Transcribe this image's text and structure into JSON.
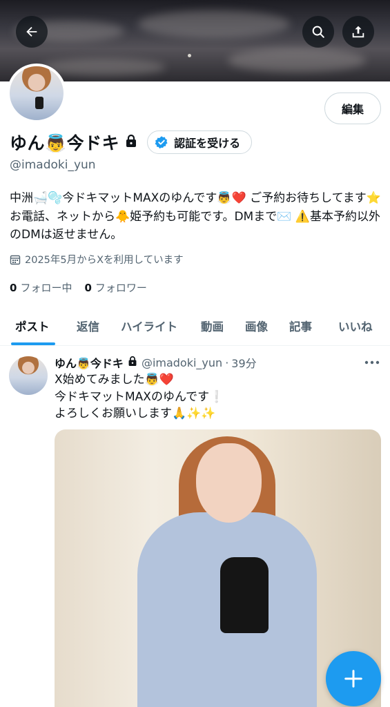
{
  "profile": {
    "name": "ゆん👼今ドキ",
    "handle": "@imadoki_yun",
    "edit_label": "編集",
    "verify_label": "認証を受ける",
    "bio": "中洲🛁🫧今ドキマットMAXのゆんです👼❤️ ご予約お待ちしてます⭐お電話、ネットから🐥姫予約も可能です。DMまで✉️ ⚠️基本予約以外のDMは返せません。",
    "joined": "2025年5月からXを利用しています",
    "following_count": "0",
    "following_label": "フォロー中",
    "followers_count": "0",
    "followers_label": "フォロワー"
  },
  "tabs": [
    "ポスト",
    "返信",
    "ハイライト",
    "動画",
    "画像",
    "記事",
    "いいね"
  ],
  "post": {
    "name": "ゆん👼今ドキ",
    "handle": "@imadoki_yun",
    "time": "39分",
    "dot": "·",
    "text": "X始めてみました👼❤️\n今ドキマットMAXのゆんです❕\nよろしくお願いします🙏✨✨"
  },
  "icons": {
    "back": "arrow-left-icon",
    "search": "search-icon",
    "share": "share-icon",
    "lock": "lock-icon",
    "verified": "verified-badge-icon",
    "calendar": "calendar-icon",
    "more": "more-dots-icon",
    "compose": "plus-icon"
  },
  "colors": {
    "accent": "#1d9bf0",
    "text": "#0f1419",
    "secondary": "#536471"
  }
}
